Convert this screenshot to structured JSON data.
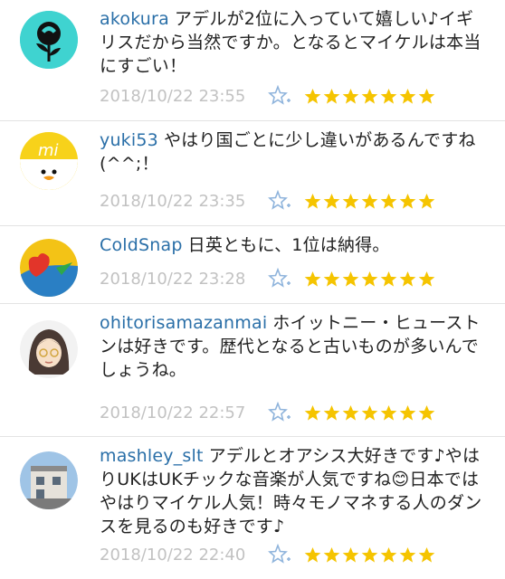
{
  "comments": [
    {
      "username": "akokura",
      "text": "アデルが2位に入っていて嬉しい♪イギリスだから当然ですか。となるとマイケルは本当にすごい！",
      "timestamp": "2018/10/22 23:55",
      "stars": 7,
      "avatar": "rose-icon"
    },
    {
      "username": "yuki53",
      "text": "やはり国ごとに少し違いがあるんですね(^^;！",
      "timestamp": "2018/10/22 23:35",
      "stars": 7,
      "avatar": "duck-icon"
    },
    {
      "username": "ColdSnap",
      "text": "日英ともに、1位は納得。",
      "timestamp": "2018/10/22 23:28",
      "stars": 7,
      "avatar": "heart-icon"
    },
    {
      "username": "ohitorisamazanmai",
      "text": "ホイットニー・ヒューストンは好きです。歴代となると古いものが多いんでしょうね。",
      "timestamp": "2018/10/22 22:57",
      "stars": 7,
      "avatar": "girl-icon"
    },
    {
      "username": "mashley_slt",
      "text": "アデルとオアシス大好きです♪やはりUKはUKチックな音楽が人気ですね😊日本ではやはりマイケル人気！時々モノマネする人のダンスを見るのも好きです♪",
      "timestamp": "2018/10/22 22:40",
      "stars": 7,
      "avatar": "house-icon"
    }
  ],
  "colors": {
    "username": "#2a6fa8",
    "timestamp": "#c2c2c2",
    "star": "#f5c400",
    "fav_icon": "#8fb4dc"
  }
}
